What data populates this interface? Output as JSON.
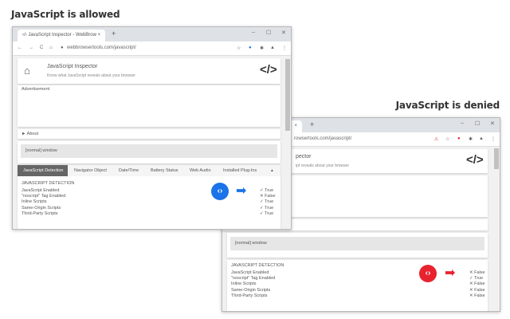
{
  "captions": {
    "allowed": "JavaScript is allowed",
    "denied": "JavaScript is denied"
  },
  "colors": {
    "allowed_accent": "#1a73e8",
    "denied_accent": "#e8232f",
    "logo_slash": "#d81b3c"
  },
  "browser_allowed": {
    "tab_title": "JavaScript Inspector - WebBrow",
    "url": "webbrowsertools.com/javascript/",
    "header": {
      "title": "JavaScript Inspector",
      "subtitle": "Know what JavaScript reveals about your browser",
      "logo": "</>"
    },
    "ad_label": "Advertisement",
    "about": "► About",
    "window_type": "[normal] window",
    "tabs": [
      "JavaScript Detection",
      "Navigator Object",
      "Date/Time",
      "Battery Status",
      "Web Audio",
      "Installed Plug-Ins"
    ],
    "section_title": "JAVASCRIPT DETECTION",
    "rows": [
      {
        "label": "JavaScript Enabled",
        "value": "✓ True"
      },
      {
        "label": "\"noscript\" Tag Enabled",
        "value": "✕ False"
      },
      {
        "label": "Inline Scripts",
        "value": "✓ True"
      },
      {
        "label": "Same-Origin Scripts",
        "value": "✓ True"
      },
      {
        "label": "Third-Party Scripts",
        "value": "✓ True"
      }
    ]
  },
  "browser_denied": {
    "url": "rowsertools.com/javascript/",
    "header": {
      "title": "pector",
      "subtitle": "ipt reveals about your browser",
      "logo": "</>"
    },
    "window_type": "[normal] window",
    "section_title": "JAVASCRIPT DETECTION",
    "rows": [
      {
        "label": "JavaScript Enabled",
        "value": "✕ False"
      },
      {
        "label": "\"noscript\" Tag Enabled",
        "value": "✓ True"
      },
      {
        "label": "Inline Scripts",
        "value": "✕ False"
      },
      {
        "label": "Same-Origin Scripts",
        "value": "✕ False"
      },
      {
        "label": "Third-Party Scripts",
        "value": "✕ False"
      }
    ]
  }
}
